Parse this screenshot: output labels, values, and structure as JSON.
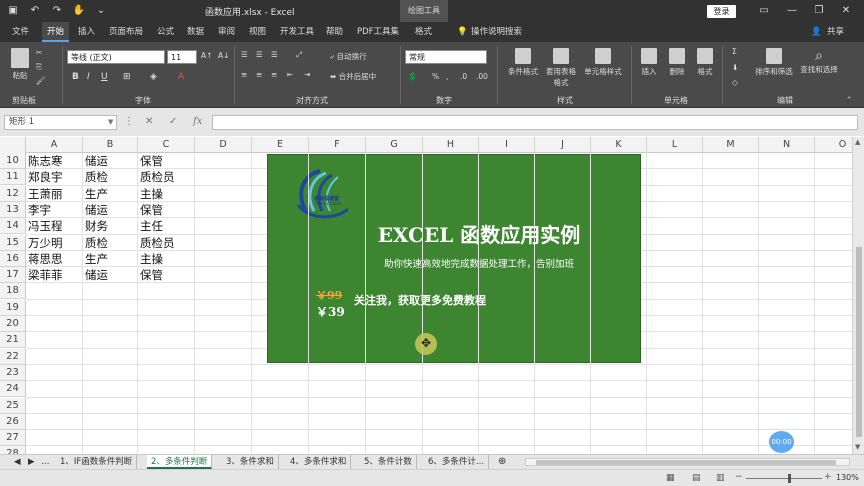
{
  "window": {
    "title": "函数应用.xlsx - Excel",
    "contextual_tab": "绘图工具",
    "login_label": "登录",
    "share_label": "共享"
  },
  "ribbon_tabs": [
    "文件",
    "开始",
    "插入",
    "页面布局",
    "公式",
    "数据",
    "审阅",
    "视图",
    "开发工具",
    "帮助",
    "PDF工具集",
    "格式"
  ],
  "tell_me": "操作说明搜索",
  "ribbon": {
    "paste_label": "粘贴",
    "font_name": "等线 (正文)",
    "font_size": "11",
    "number_format": "常规",
    "wrap_text": "自动换行",
    "merge_center": "合并后居中",
    "conditional_format": "条件格式",
    "format_as_table": "套用表格格式",
    "cell_styles": "单元格样式",
    "insert": "插入",
    "delete": "删除",
    "format": "格式",
    "sort_filter": "排序和筛选",
    "find_select": "查找和选择",
    "groups": {
      "clipboard": "剪贴板",
      "font": "字体",
      "alignment": "对齐方式",
      "number": "数字",
      "styles": "样式",
      "cells": "单元格",
      "editing": "编辑"
    }
  },
  "formula_bar": {
    "name_box": "矩形 1",
    "formula": "",
    "fx": "fx"
  },
  "columns": [
    "A",
    "B",
    "C",
    "D",
    "E",
    "F",
    "G",
    "H",
    "I",
    "J",
    "K",
    "L",
    "M",
    "N",
    "O"
  ],
  "rows": [
    "10",
    "11",
    "12",
    "13",
    "14",
    "15",
    "16",
    "17",
    "18",
    "19",
    "20",
    "21",
    "22",
    "23",
    "24",
    "25",
    "26",
    "27",
    "28"
  ],
  "table_rows": [
    [
      "陈志寒",
      "储运",
      "保管"
    ],
    [
      "郑良宇",
      "质检",
      "质检员"
    ],
    [
      "王萧丽",
      "生产",
      "主操"
    ],
    [
      "李宇",
      "储运",
      "保管"
    ],
    [
      "冯玉程",
      "财务",
      "主任"
    ],
    [
      "万少明",
      "质检",
      "质检员"
    ],
    [
      "蒋思思",
      "生产",
      "主操"
    ],
    [
      "梁菲菲",
      "储运",
      "保管"
    ]
  ],
  "banner": {
    "title": "EXCEL 函数应用实例",
    "subtitle": "助你快速高效地完成数据处理工作，告别加班",
    "old_price": "￥99",
    "new_price": "￥39",
    "promo": "关注我，获取更多免费教程",
    "logo_text": "会会溜课堂",
    "logo_sub": "Micro Class",
    "bg_color": "#3d8531"
  },
  "timer": "00:00",
  "sheet_tabs": [
    "1、IF函数条件判断",
    "2、多条件判断",
    "3、条件求和",
    "4、多条件求和",
    "5、条件计数",
    "6、多条件计..."
  ],
  "active_sheet": "2、多条件判断",
  "zoom": "130%"
}
